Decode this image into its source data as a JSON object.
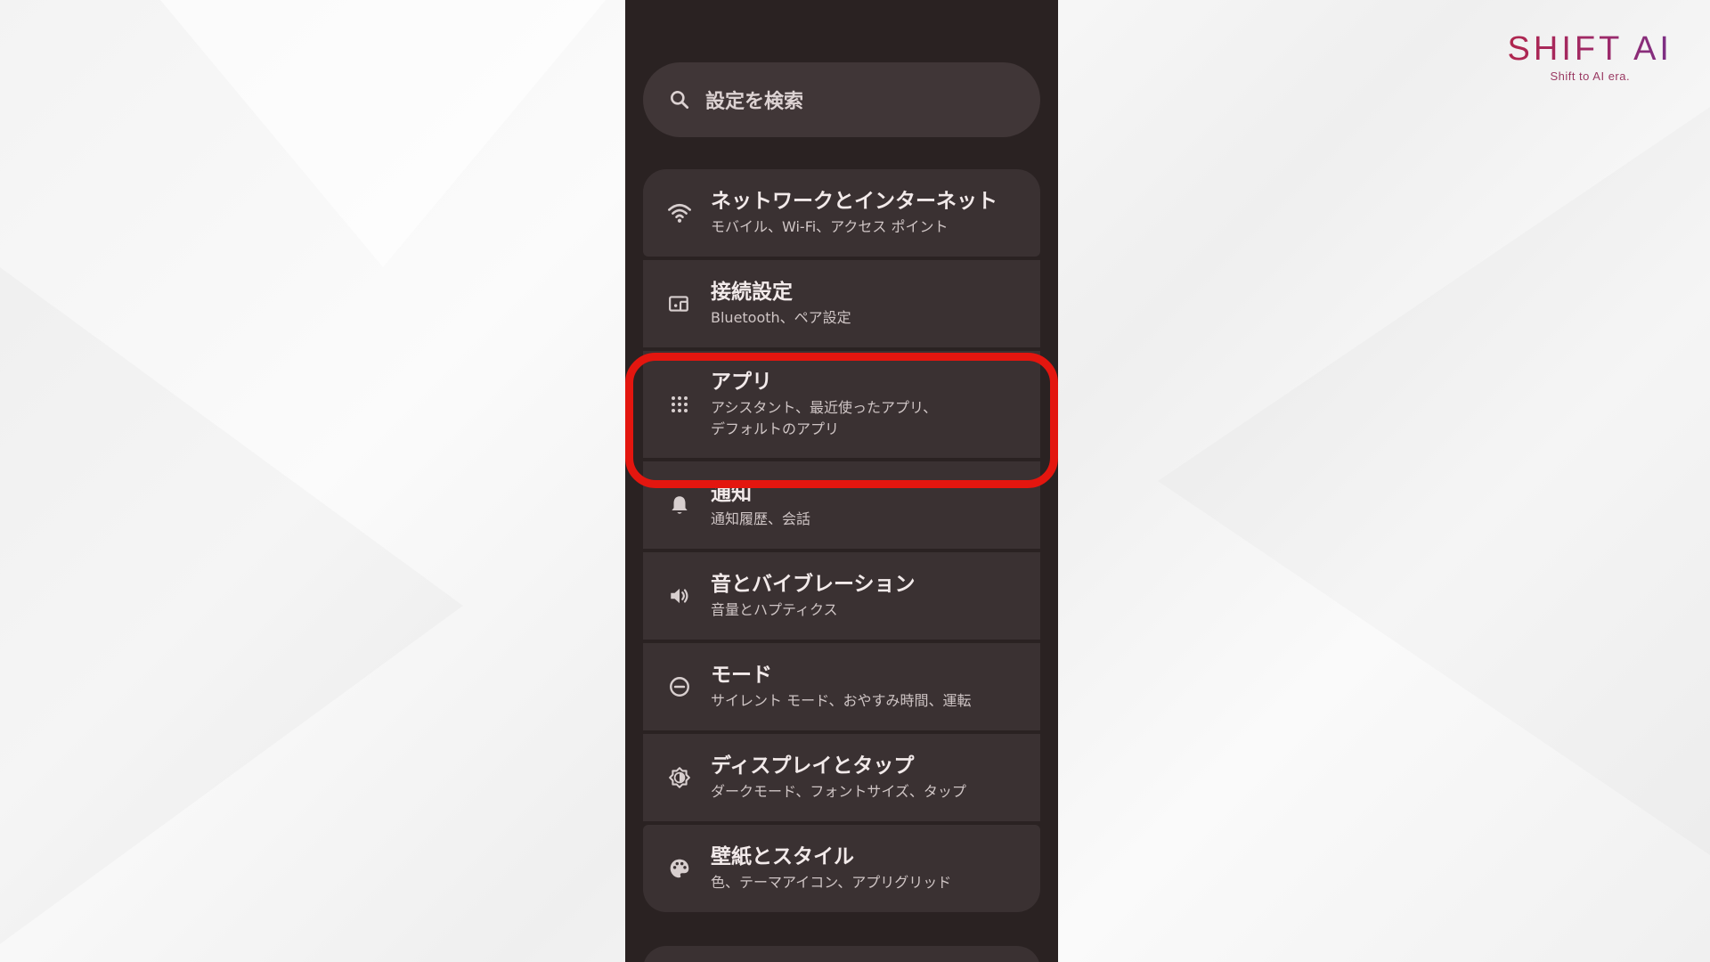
{
  "brand": {
    "name": "SHIFT AI",
    "tagline": "Shift to AI era."
  },
  "search": {
    "placeholder": "設定を検索",
    "icon": "search-icon"
  },
  "highlight_color": "#e3160f",
  "settings": [
    {
      "title": "ネットワークとインターネット",
      "subtitle": "モバイル、Wi-Fi、アクセス ポイント",
      "icon": "wifi-icon"
    },
    {
      "title": "接続設定",
      "subtitle": "Bluetooth、ペア設定",
      "icon": "connected-devices-icon"
    },
    {
      "title": "アプリ",
      "subtitle": "アシスタント、最近使ったアプリ、\nデフォルトのアプリ",
      "icon": "apps-grid-icon",
      "highlighted": true
    },
    {
      "title": "通知",
      "subtitle": "通知履歴、会話",
      "icon": "bell-icon"
    },
    {
      "title": "音とバイブレーション",
      "subtitle": "音量とハプティクス",
      "icon": "volume-icon"
    },
    {
      "title": "モード",
      "subtitle": "サイレント モード、おやすみ時間、運転",
      "icon": "do-not-disturb-icon"
    },
    {
      "title": "ディスプレイとタップ",
      "subtitle": "ダークモード、フォントサイズ、タップ",
      "icon": "brightness-icon"
    },
    {
      "title": "壁紙とスタイル",
      "subtitle": "色、テーマアイコン、アプリグリッド",
      "icon": "palette-icon"
    }
  ]
}
